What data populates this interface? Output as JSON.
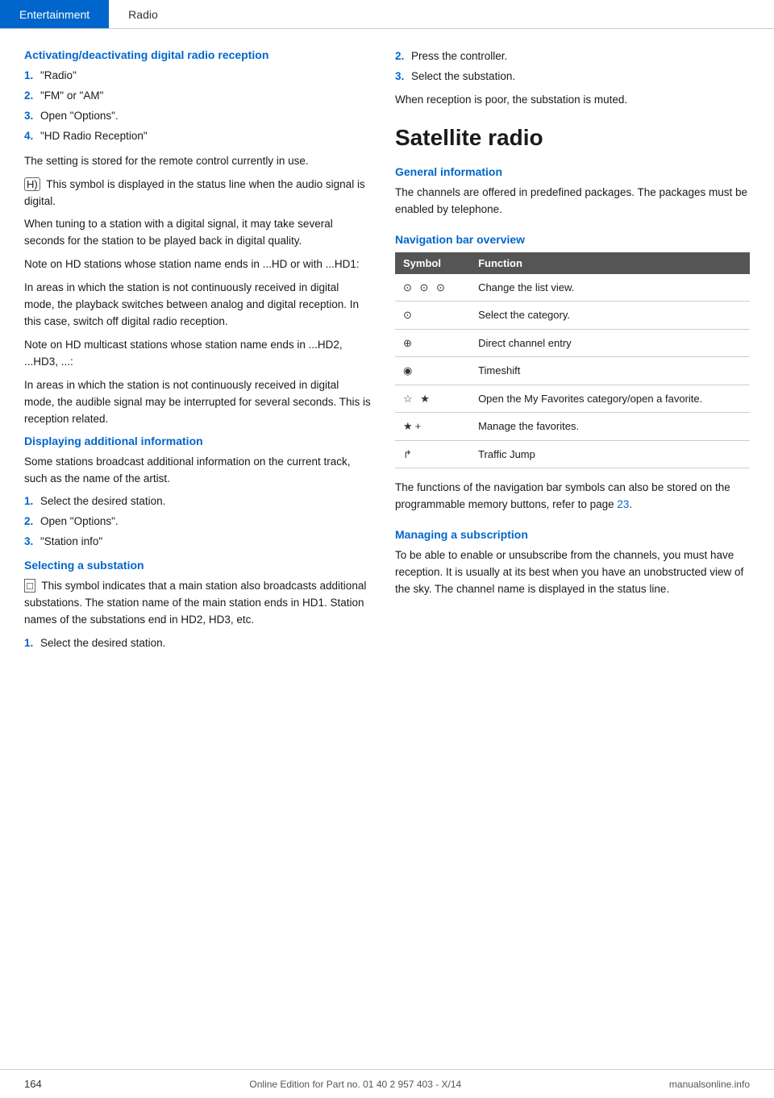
{
  "nav": {
    "items": [
      {
        "label": "Entertainment",
        "active": true
      },
      {
        "label": "Radio",
        "active": false
      }
    ]
  },
  "left": {
    "section1": {
      "heading": "Activating/deactivating digital radio reception",
      "steps": [
        {
          "num": "1.",
          "text": "\"Radio\""
        },
        {
          "num": "2.",
          "text": "\"FM\" or \"AM\""
        },
        {
          "num": "3.",
          "text": "Open \"Options\"."
        },
        {
          "num": "4.",
          "text": "\"HD Radio Reception\""
        }
      ],
      "note1": "The setting is stored for the remote control currently in use.",
      "note2": "This symbol is displayed in the status line when the audio signal is digital.",
      "note3": "When tuning to a station with a digital signal, it may take several seconds for the station to be played back in digital quality.",
      "note4": "Note on HD stations whose station name ends in ...HD or with ...HD1:",
      "note5": "In areas in which the station is not continuously received in digital mode, the playback switches between analog and digital reception. In this case, switch off digital radio reception.",
      "note6": "Note on HD multicast stations whose station name ends in ...HD2, ...HD3, ...:",
      "note7": "In areas in which the station is not continuously received in digital mode, the audible signal may be interrupted for several seconds. This is reception related."
    },
    "section2": {
      "heading": "Displaying additional information",
      "body": "Some stations broadcast additional information on the current track, such as the name of the artist.",
      "steps": [
        {
          "num": "1.",
          "text": "Select the desired station."
        },
        {
          "num": "2.",
          "text": "Open \"Options\"."
        },
        {
          "num": "3.",
          "text": "\"Station info\""
        }
      ]
    },
    "section3": {
      "heading": "Selecting a substation",
      "note": "This symbol indicates that a main station also broadcasts additional substations. The station name of the main station ends in HD1. Station names of the substations end in HD2, HD3, etc.",
      "steps": [
        {
          "num": "1.",
          "text": "Select the desired station."
        }
      ]
    }
  },
  "right": {
    "substation_steps": [
      {
        "num": "2.",
        "text": "Press the controller."
      },
      {
        "num": "3.",
        "text": "Select the substation."
      }
    ],
    "substation_note": "When reception is poor, the substation is muted.",
    "satellite_heading": "Satellite radio",
    "general_heading": "General information",
    "general_body": "The channels are offered in predefined packages. The packages must be enabled by telephone.",
    "navtable_heading": "Navigation bar overview",
    "navtable_headers": [
      "Symbol",
      "Function"
    ],
    "navtable_rows": [
      {
        "symbol": "⊙ ⊙ ⊙",
        "function": "Change the list view."
      },
      {
        "symbol": "⊙",
        "function": "Select the category."
      },
      {
        "symbol": "⊕",
        "function": "Direct channel entry"
      },
      {
        "symbol": "◉",
        "function": "Timeshift"
      },
      {
        "symbol": "☆ ✦",
        "function": "Open the My Favorites category/open a favorite."
      },
      {
        "symbol": "✦+",
        "function": "Manage the favorites."
      },
      {
        "symbol": "↱",
        "function": "Traffic Jump"
      }
    ],
    "navtable_footer": "The functions of the navigation bar symbols can also be stored on the programmable memory buttons, refer to page 23.",
    "managing_heading": "Managing a subscription",
    "managing_body": "To be able to enable or unsubscribe from the channels, you must have reception. It is usually at its best when you have an unobstructed view of the sky. The channel name is displayed in the status line."
  },
  "footer": {
    "page_number": "164",
    "copyright": "Online Edition for Part no. 01 40 2 957 403 - X/14",
    "watermark": "manualsonline.info"
  }
}
